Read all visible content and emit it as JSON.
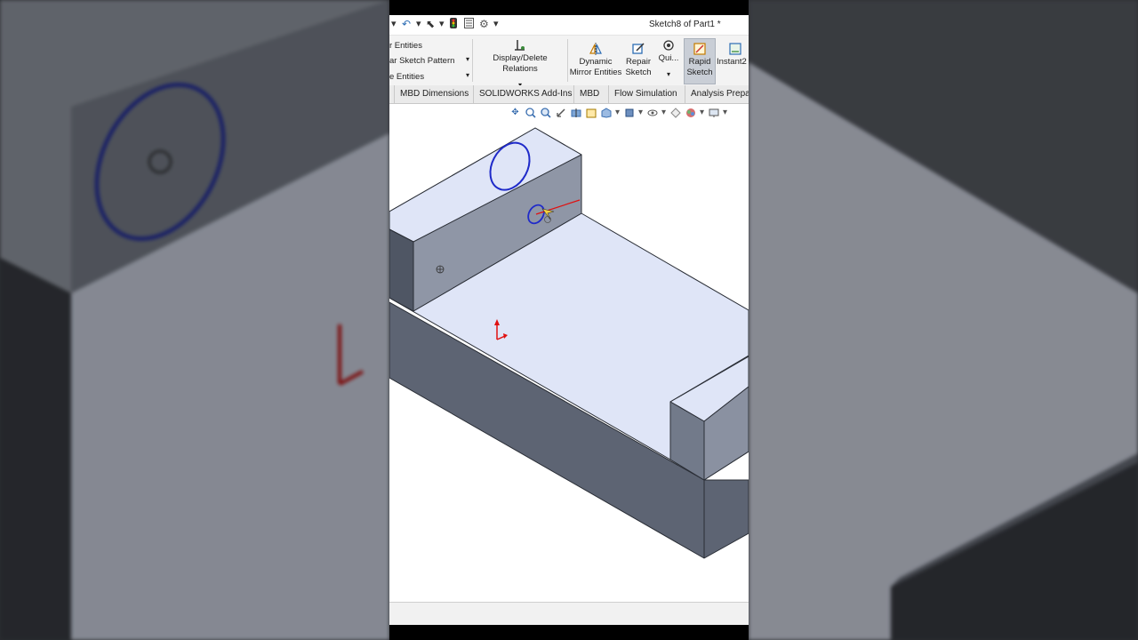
{
  "window": {
    "title": "Sketch8 of Part1 *"
  },
  "quick_access": {
    "icons": [
      "chevron-down-icon",
      "undo-icon",
      "chevron-down-icon",
      "select-arrow-icon",
      "chevron-down-icon",
      "traffic-light-icon",
      "file-properties-icon",
      "options-gear-icon",
      "chevron-down-icon"
    ]
  },
  "ribbon": {
    "mirror_entities": "r Entities",
    "linear_pattern": "ar Sketch Pattern",
    "move_entities": "e Entities",
    "display_relations": "Display/Delete Relations",
    "dynamic_mirror_1": "Dynamic",
    "dynamic_mirror_2": "Mirror Entities",
    "repair_1": "Repair",
    "repair_2": "Sketch",
    "quick_snaps": "Qui...",
    "rapid_1": "Rapid",
    "rapid_2": "Sketch",
    "instant2d": "Instant2"
  },
  "tabs": [
    "MBD Dimensions",
    "SOLIDWORKS Add-Ins",
    "MBD",
    "Flow Simulation",
    "Analysis Prepar"
  ],
  "view_toolbar": {
    "icons": [
      "move-view-icon",
      "zoom-fit-icon",
      "zoom-area-icon",
      "previous-view-icon",
      "section-view-icon",
      "dynamic-annotation-icon",
      "view-orientation-icon",
      "display-style-icon",
      "hide-show-icon",
      "appearance-icon",
      "scene-icon",
      "monitor-icon"
    ]
  },
  "colors": {
    "model_top": "#dfe5f7",
    "model_side": "#5b6270",
    "model_front": "#8c93a3",
    "sketch_circle": "#1f2ac9",
    "axis_red": "#e01010"
  }
}
